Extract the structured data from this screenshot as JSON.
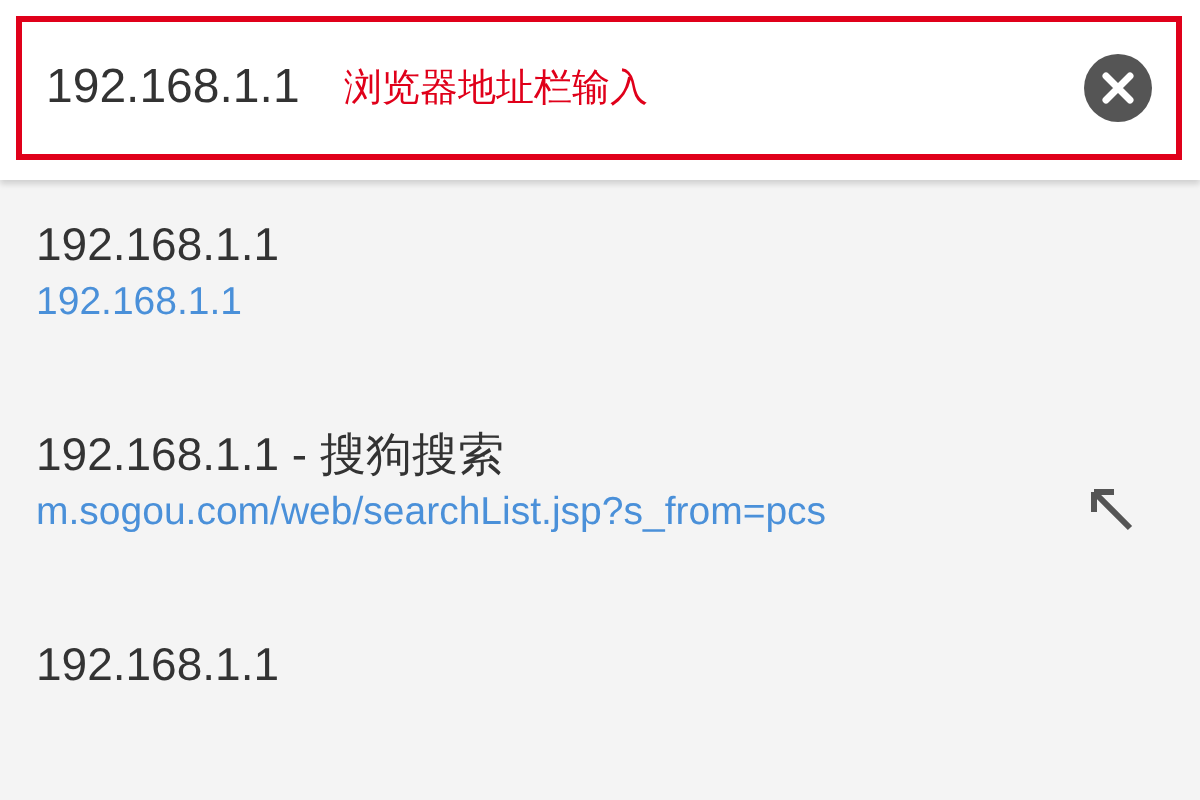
{
  "address_bar": {
    "value": "192.168.1.1",
    "annotation": "浏览器地址栏输入"
  },
  "suggestions": [
    {
      "title": "192.168.1.1",
      "url": "192.168.1.1",
      "fill_button": false
    },
    {
      "title": "192.168.1.1 - 搜狗搜索",
      "url": "m.sogou.com/web/searchList.jsp?s_from=pcs",
      "fill_button": true
    },
    {
      "title": "192.168.1.1",
      "fill_button": false
    }
  ]
}
